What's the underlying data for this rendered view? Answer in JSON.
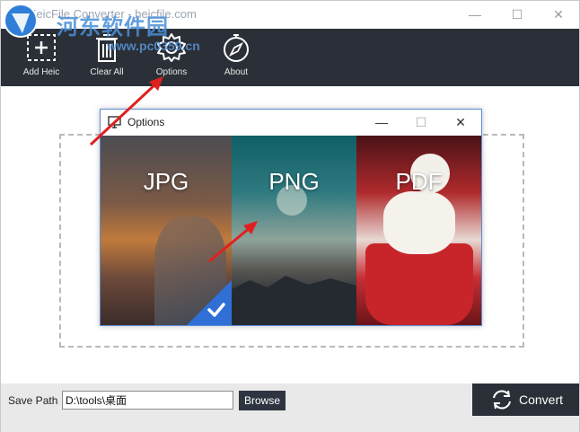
{
  "window": {
    "title": "HeicFile Converter - heicfile.com",
    "minimize": "—",
    "maximize": "☐",
    "close": "✕"
  },
  "watermark": {
    "text": "河东软件园",
    "url": "www.pc0359.cn"
  },
  "toolbar": {
    "add_heic": "Add Heic",
    "clear_all": "Clear All",
    "options": "Options",
    "about": "About"
  },
  "dialog": {
    "title": "Options",
    "minimize": "—",
    "maximize": "☐",
    "close": "✕",
    "formats": [
      {
        "label": "JPG",
        "selected": true
      },
      {
        "label": "PNG",
        "selected": false
      },
      {
        "label": "PDF",
        "selected": false
      }
    ]
  },
  "bottom": {
    "save_path_label": "Save Path",
    "save_path_value": "D:\\tools\\桌面",
    "browse_label": "Browse",
    "convert_label": "Convert"
  },
  "colors": {
    "toolbar_bg": "#2b3038",
    "selected_accent": "#2f6fd6",
    "annotation_arrow": "#e02020"
  }
}
